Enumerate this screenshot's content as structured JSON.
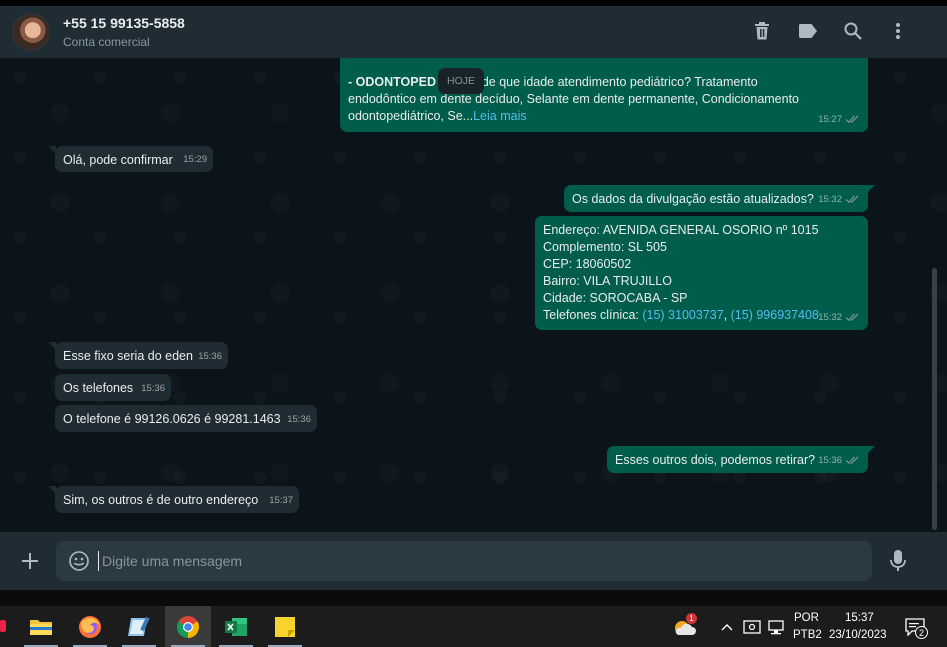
{
  "header": {
    "contact_name": "+55 15 99135-5858",
    "contact_subtitle": "Conta comercial",
    "icons": [
      "trash-icon",
      "label-icon",
      "search-icon",
      "more-vertical-icon"
    ]
  },
  "chat": {
    "date_chip": "HOJE",
    "messages": [
      {
        "direction": "out",
        "bold": "- ODONTOPED",
        "text_after_bold": " a partir de que idade atendimento pediátrico? Tratamento",
        "line2": "endodôntico em dente decíduo, Selante em dente permanente, Condicionamento",
        "line3": "odontopediátrico, Se...",
        "read_more": "Leia mais",
        "time": "15:27"
      },
      {
        "direction": "in",
        "text": "Olá, pode confirmar",
        "time": "15:29"
      },
      {
        "direction": "out",
        "text": "Os dados da divulgação estão atualizados?",
        "time": "15:32"
      },
      {
        "direction": "out",
        "lines": [
          "Endereço: AVENIDA GENERAL OSORIO nº 1015",
          "Complemento: SL 505",
          "CEP: 18060502",
          "Bairro: VILA TRUJILLO",
          "Cidade: SOROCABA - SP"
        ],
        "phones_label": "Telefones clínica: ",
        "phone1": "(15) 31003737",
        "sep": ", ",
        "phone2": "(15) 996937408",
        "time": "15:32"
      },
      {
        "direction": "in",
        "text": "Esse fixo seria do eden",
        "time": "15:36"
      },
      {
        "direction": "in",
        "text": "Os telefones",
        "time": "15:36"
      },
      {
        "direction": "in",
        "text": "O telefone é 99126.0626 é 99281.1463",
        "time": "15:36"
      },
      {
        "direction": "out",
        "text": "Esses outros dois, podemos retirar?",
        "time": "15:36"
      },
      {
        "direction": "in",
        "text": "Sim, os outros é de outro endereço",
        "time": "15:37"
      }
    ]
  },
  "composer": {
    "placeholder": "Digite uma mensagem"
  },
  "taskbar": {
    "apps": [
      "file-explorer-icon",
      "firefox-icon",
      "notepad-icon",
      "chrome-icon",
      "excel-icon",
      "sticky-notes-icon"
    ],
    "weather_badge": "1",
    "language_line1": "POR",
    "language_line2": "PTB2",
    "clock_time": "15:37",
    "clock_date": "23/10/2023",
    "notifications_count": "2"
  },
  "colors": {
    "chat_bg": "#0b141a",
    "header_bg": "#202c33",
    "incoming_bubble": "#202c33",
    "outgoing_bubble": "#005c4b",
    "link": "#53bdeb",
    "read_ticks": "#8696a0"
  }
}
